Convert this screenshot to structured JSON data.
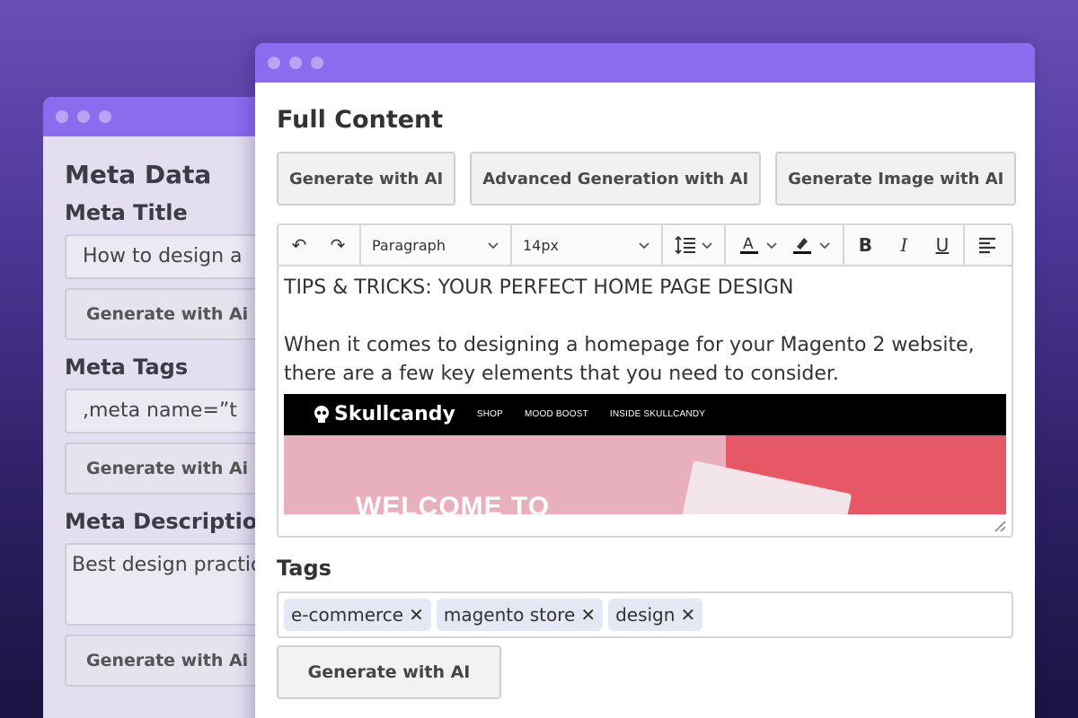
{
  "meta_window": {
    "heading": "Meta Data",
    "meta_title": {
      "label": "Meta Title",
      "value": "How to design a",
      "button": "Generate with Ai"
    },
    "meta_tags": {
      "label": "Meta Tags",
      "value": ",meta name=”t",
      "button": "Generate with Ai"
    },
    "meta_description": {
      "label": "Meta Description",
      "value": "Best design practic",
      "button": "Generate with Ai"
    }
  },
  "content_window": {
    "heading": "Full Content",
    "ai_buttons": [
      "Generate with AI",
      "Advanced Generation with AI",
      "Generate Image with AI"
    ],
    "toolbar": {
      "undo_icon": "↶",
      "redo_icon": "↷",
      "block_format": "Paragraph",
      "font_size": "14px",
      "line_height_icon": "line-height-icon",
      "font_color_icon": "A",
      "highlight_icon": "highlighter-icon",
      "bold": "B",
      "italic": "I",
      "underline": "U",
      "align_icon": "align-left-icon"
    },
    "editor": {
      "heading_line": "TIPS & TRICKS: YOUR PERFECT HOME PAGE DESIGN",
      "paragraph_line1": "When it comes to designing a homepage for your Magento 2 website,",
      "paragraph_line2": "there are a few key elements that you need to consider.",
      "image": {
        "brand": "Skullcandy",
        "nav": [
          "SHOP",
          "MOOD BOOST",
          "INSIDE SKULLCANDY"
        ],
        "hero_text": "WELCOME TO"
      }
    },
    "tags_label": "Tags",
    "tags": [
      "e-commerce",
      "magento store",
      "design"
    ],
    "tag_remove_icon": "✕",
    "generate_button": "Generate with AI"
  },
  "colors": {
    "titlebar": "#8a6cee",
    "window_dots": "#b7a4f3",
    "background_top": "#6a4fb8",
    "background_bottom": "#1b1340",
    "tag_chip": "#e4e7f4",
    "hero_pink": "#e8b0bc",
    "hero_red": "#e65866"
  }
}
